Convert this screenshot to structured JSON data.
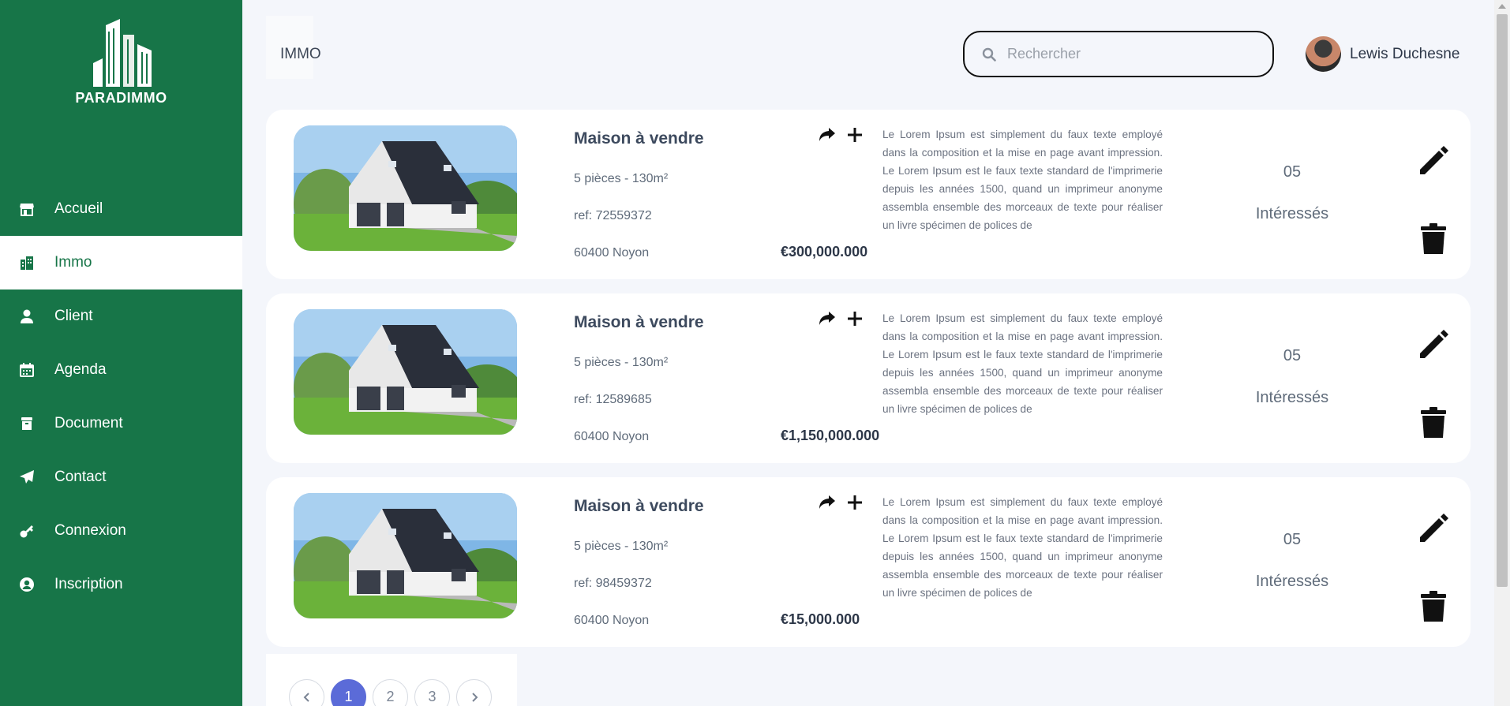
{
  "app": {
    "brand": "PARADIMMO",
    "accent": "#177548"
  },
  "sidebar": {
    "items": [
      {
        "label": "Accueil",
        "icon": "store-icon"
      },
      {
        "label": "Immo",
        "icon": "building-icon",
        "active": true
      },
      {
        "label": "Client",
        "icon": "user-icon"
      },
      {
        "label": "Agenda",
        "icon": "calendar-icon"
      },
      {
        "label": "Document",
        "icon": "archive-icon"
      },
      {
        "label": "Contact",
        "icon": "paper-plane-icon"
      },
      {
        "label": "Connexion",
        "icon": "key-icon"
      },
      {
        "label": "Inscription",
        "icon": "user-circle-icon"
      }
    ]
  },
  "header": {
    "breadcrumb": "IMMO",
    "search_placeholder": "Rechercher",
    "user_name": "Lewis Duchesne"
  },
  "listings": [
    {
      "title": "Maison à vendre",
      "rooms": "5 pièces - 130m²",
      "ref": "ref: 72559372",
      "location": "60400 Noyon",
      "price": "€300,000.000",
      "description": "Le Lorem Ipsum est simplement du faux texte employé dans la composition et la mise en page avant impression. Le Lorem Ipsum est le faux texte standard de l'imprimerie depuis les années 1500, quand un imprimeur anonyme assembla ensemble des morceaux de texte pour réaliser un livre spécimen de polices de",
      "count": "05",
      "interested_label": "Intéressés"
    },
    {
      "title": "Maison à vendre",
      "rooms": "5 pièces - 130m²",
      "ref": "ref: 12589685",
      "location": "60400 Noyon",
      "price": "€1,150,000.000",
      "description": "Le Lorem Ipsum est simplement du faux texte employé dans la composition et la mise en page avant impression. Le Lorem Ipsum est le faux texte standard de l'imprimerie depuis les années 1500, quand un imprimeur anonyme assembla ensemble des morceaux de texte pour réaliser un livre spécimen de polices de",
      "count": "05",
      "interested_label": "Intéressés"
    },
    {
      "title": "Maison à vendre",
      "rooms": "5 pièces - 130m²",
      "ref": "ref: 98459372",
      "location": "60400 Noyon",
      "price": "€15,000.000",
      "description": "Le Lorem Ipsum est simplement du faux texte employé dans la composition et la mise en page avant impression. Le Lorem Ipsum est le faux texte standard de l'imprimerie depuis les années 1500, quand un imprimeur anonyme assembla ensemble des morceaux de texte pour réaliser un livre spécimen de polices de",
      "count": "05",
      "interested_label": "Intéressés"
    }
  ],
  "pagination": {
    "pages": [
      "1",
      "2",
      "3"
    ],
    "current": "1"
  }
}
